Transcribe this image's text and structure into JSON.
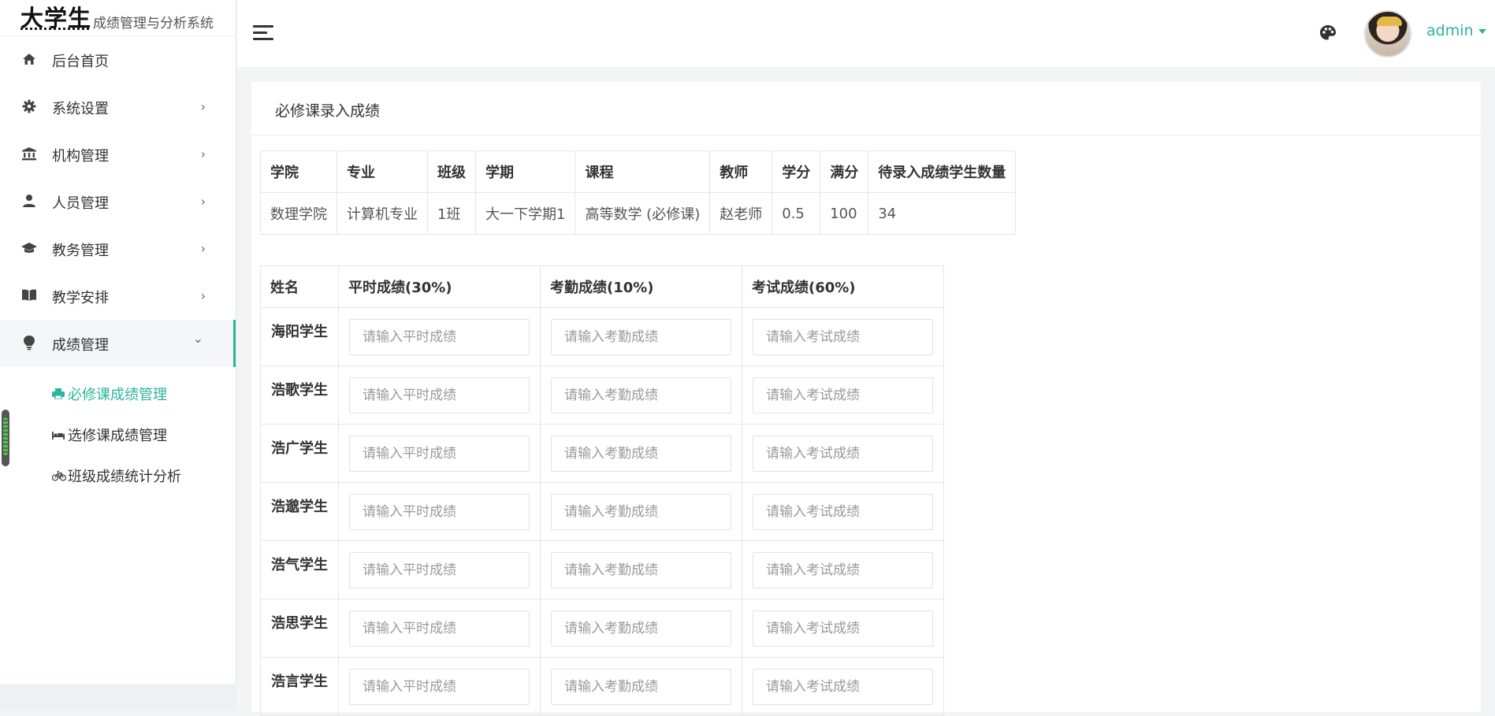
{
  "brand": {
    "main": "大学生",
    "sub": "成绩管理与分析系统"
  },
  "sidebar": {
    "items": [
      {
        "label": "后台首页",
        "icon": "home-icon",
        "arrow": ""
      },
      {
        "label": "系统设置",
        "icon": "gear-icon",
        "arrow": "›"
      },
      {
        "label": "机构管理",
        "icon": "institution-icon",
        "arrow": "›"
      },
      {
        "label": "人员管理",
        "icon": "user-icon",
        "arrow": "›"
      },
      {
        "label": "教务管理",
        "icon": "graduation-cap-icon",
        "arrow": "›"
      },
      {
        "label": "教学安排",
        "icon": "book-icon",
        "arrow": "›"
      },
      {
        "label": "成绩管理",
        "icon": "lightbulb-icon",
        "arrow": "⌄"
      }
    ],
    "subitems": [
      {
        "label": "必修课成绩管理",
        "icon": "printer-icon"
      },
      {
        "label": "选修课成绩管理",
        "icon": "bed-icon"
      },
      {
        "label": "班级成绩统计分析",
        "icon": "bicycle-icon"
      }
    ]
  },
  "header": {
    "username": "admin"
  },
  "colors": {
    "accent": "#2bb59a"
  },
  "page": {
    "title": "必修课录入成绩"
  },
  "course_info": {
    "headers": [
      "学院",
      "专业",
      "班级",
      "学期",
      "课程",
      "教师",
      "学分",
      "满分",
      "待录入成绩学生数量"
    ],
    "values": [
      "数理学院",
      "计算机专业",
      "1班",
      "大一下学期1",
      "高等数学 (必修课)",
      "赵老师",
      "0.5",
      "100",
      "34"
    ]
  },
  "grades": {
    "headers": [
      "姓名",
      "平时成绩(30%)",
      "考勤成绩(10%)",
      "考试成绩(60%)"
    ],
    "placeholders": [
      "请输入平时成绩",
      "请输入考勤成绩",
      "请输入考试成绩"
    ],
    "students": [
      "海阳学生",
      "浩歌学生",
      "浩广学生",
      "浩邈学生",
      "浩气学生",
      "浩思学生",
      "浩言学生"
    ]
  }
}
